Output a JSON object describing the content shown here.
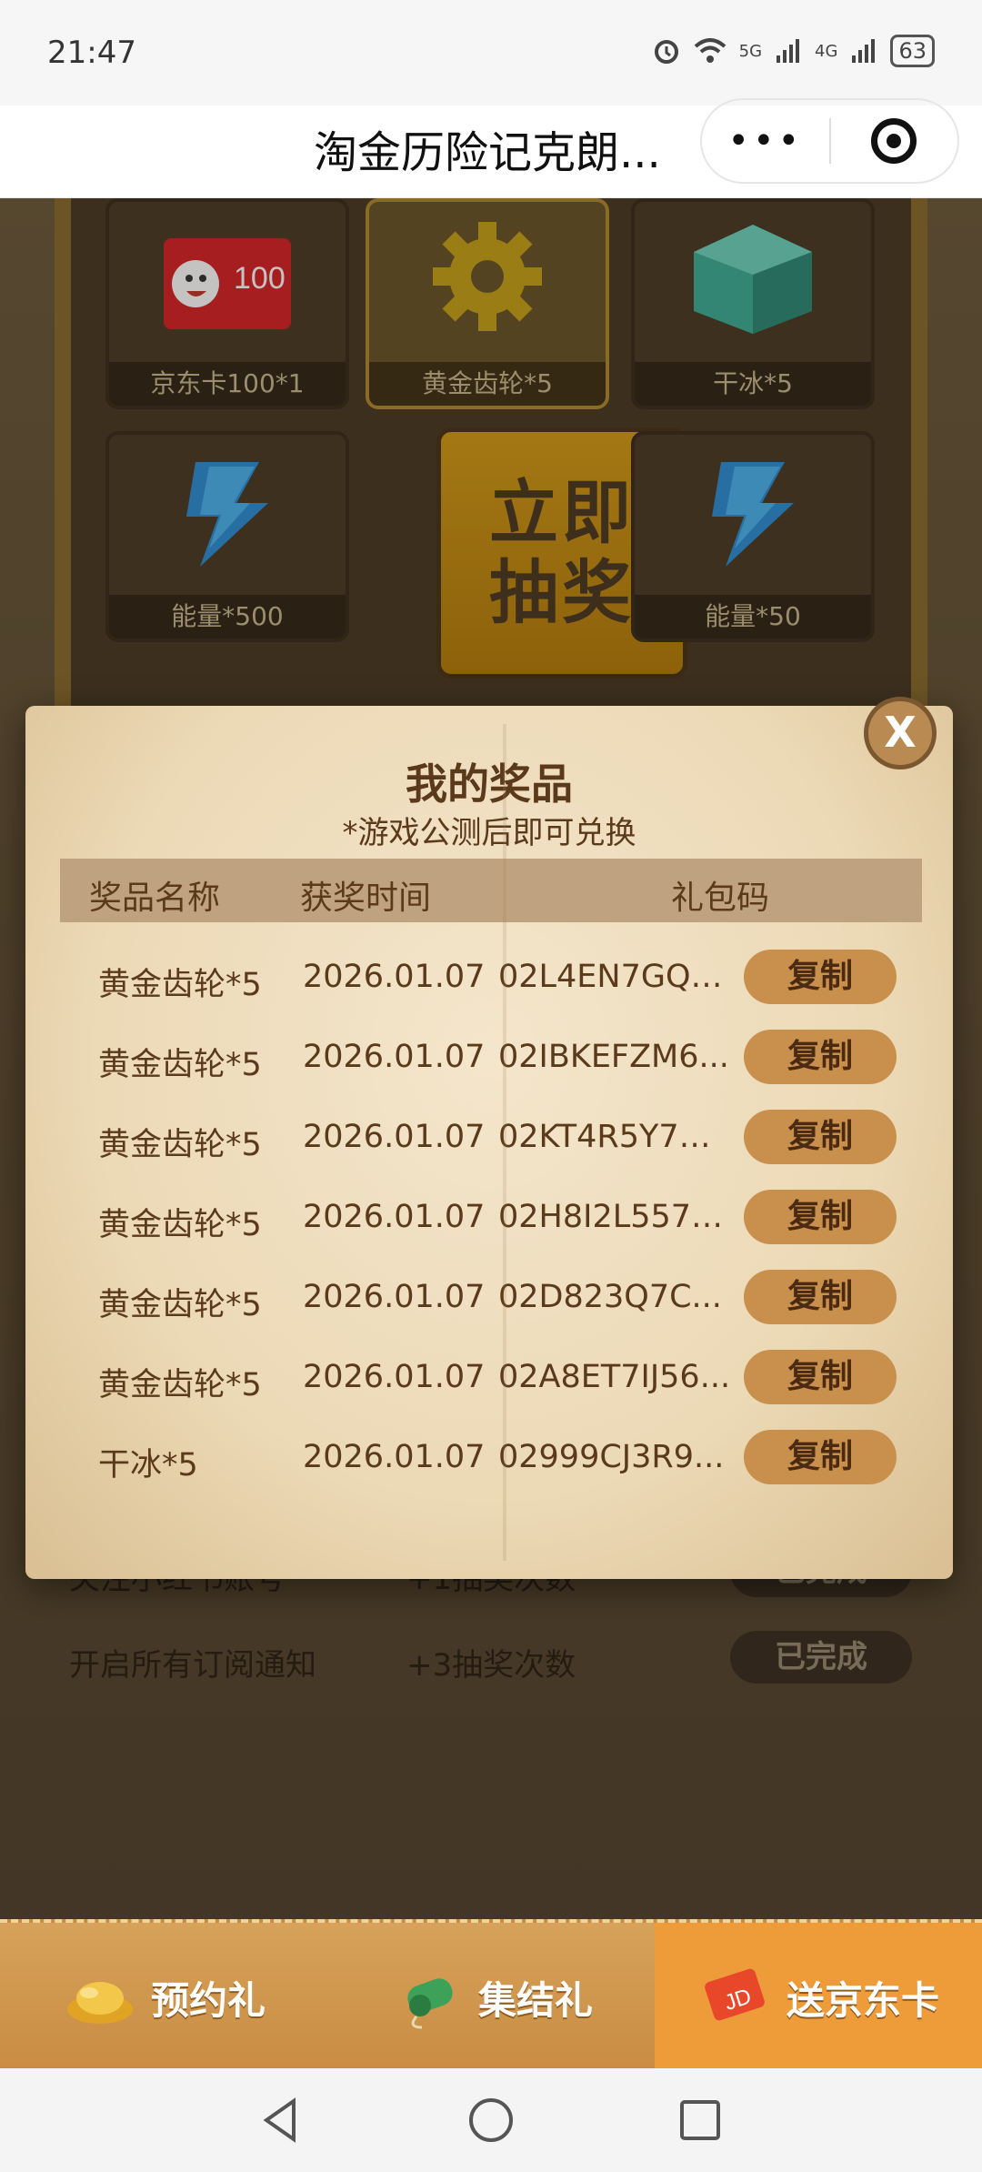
{
  "status_bar": {
    "time": "21:47",
    "signal_5g": "5G",
    "signal_4g": "4G",
    "battery": "63"
  },
  "navbar": {
    "title": "淘金历险记克朗...",
    "more_label": "•••"
  },
  "board": {
    "cells": [
      {
        "label": "京东卡100*1",
        "art_text": "100"
      },
      {
        "label": "黄金齿轮*5"
      },
      {
        "label": "干冰*5"
      },
      {
        "label": "能量*500"
      },
      {
        "label": "能量*50"
      }
    ],
    "draw_button": {
      "line1": "立即",
      "line2": "抽奖"
    }
  },
  "tasks": [
    {
      "name": "关注小红书账号",
      "reward": "+1抽奖次数",
      "status": "已完成"
    },
    {
      "name": "开启所有订阅通知",
      "reward": "+3抽奖次数",
      "status": "已完成"
    }
  ],
  "modal": {
    "close_label": "X",
    "title": "我的奖品",
    "subtitle": "*游戏公测后即可兑换",
    "headers": {
      "name": "奖品名称",
      "time": "获奖时间",
      "code": "礼包码"
    },
    "rows": [
      {
        "name": "黄金齿轮*5",
        "date": "2026.01.07",
        "code": "02L4EN7GQ3...",
        "copy": "复制"
      },
      {
        "name": "黄金齿轮*5",
        "date": "2026.01.07",
        "code": "02IBKEFZM6...",
        "copy": "复制"
      },
      {
        "name": "黄金齿轮*5",
        "date": "2026.01.07",
        "code": "02KT4R5Y7N...",
        "copy": "复制"
      },
      {
        "name": "黄金齿轮*5",
        "date": "2026.01.07",
        "code": "02H8I2L5577...",
        "copy": "复制"
      },
      {
        "name": "黄金齿轮*5",
        "date": "2026.01.07",
        "code": "02D823Q7C...",
        "copy": "复制"
      },
      {
        "name": "黄金齿轮*5",
        "date": "2026.01.07",
        "code": "02A8ET7IJ56...",
        "copy": "复制"
      },
      {
        "name": "干冰*5",
        "date": "2026.01.07",
        "code": "02999CJ3R9...",
        "copy": "复制"
      }
    ]
  },
  "tabbar": [
    {
      "label": "预约礼",
      "icon": "gold-ingot-icon"
    },
    {
      "label": "集结礼",
      "icon": "whistle-icon"
    },
    {
      "label": "送京东卡",
      "icon": "jd-card-icon",
      "active": true
    }
  ],
  "colors": {
    "accent": "#c98f4c",
    "tab_active": "#ee9b3a",
    "text_brown": "#5b3a1c"
  }
}
